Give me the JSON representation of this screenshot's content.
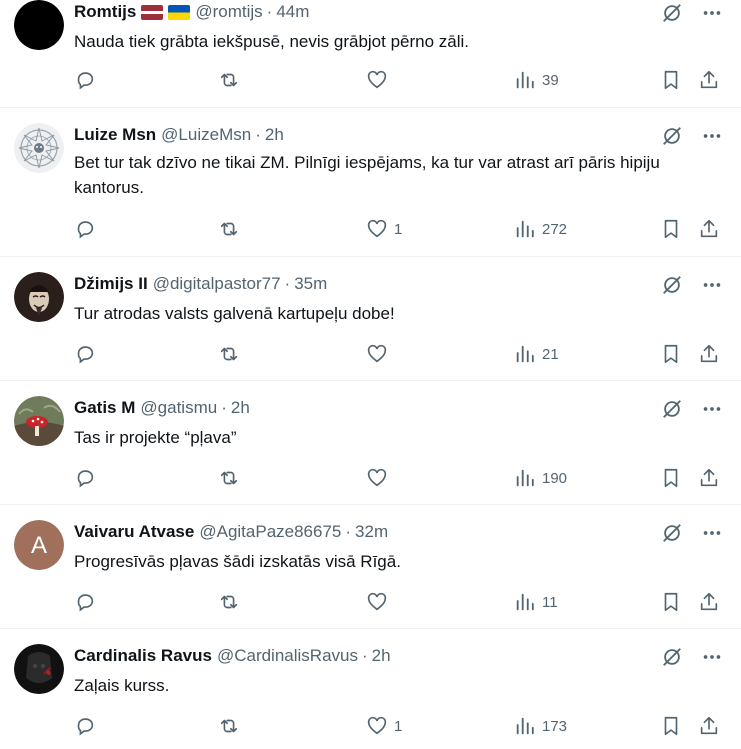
{
  "tweets": [
    {
      "name": "Romtijs",
      "flags": [
        "Latvia flag",
        "Ukraine flag"
      ],
      "handle": "@romtijs",
      "time": "44m",
      "text": "Nauda tiek grābta iekšpusē, nevis grābjot pērno zāli.",
      "replies": "",
      "retweets": "",
      "likes": "",
      "views": "39"
    },
    {
      "name": "Luize Msn",
      "handle": "@LuizeMsn",
      "time": "2h",
      "text": "Bet tur tak dzīvo ne tikai ZM. Pilnīgi iespējams, ka tur var atrast arī pāris hipiju kantorus.",
      "replies": "",
      "retweets": "",
      "likes": "1",
      "views": "272"
    },
    {
      "name": "Džimijs II",
      "handle": "@digitalpastor77",
      "time": "35m",
      "text": "Tur atrodas valsts galvenā kartupeļu dobe!",
      "replies": "",
      "retweets": "",
      "likes": "",
      "views": "21"
    },
    {
      "name": "Gatis M",
      "handle": "@gatismu",
      "time": "2h",
      "text": "Tas ir projekte “pļava”",
      "replies": "",
      "retweets": "",
      "likes": "",
      "views": "190"
    },
    {
      "name": "Vaivaru Atvase",
      "handle": "@AgitaPaze86675",
      "time": "32m",
      "avatar_letter": "A",
      "text": "Progresīvās pļavas šādi izskatās visā Rīgā.",
      "replies": "",
      "retweets": "",
      "likes": "",
      "views": "11"
    },
    {
      "name": "Cardinalis Ravus",
      "handle": "@CardinalisRavus",
      "time": "2h",
      "text": "Zaļais kurss.",
      "replies": "",
      "retweets": "",
      "likes": "1",
      "views": "173"
    }
  ],
  "separator": "·",
  "icons": {
    "grok": "grok-icon",
    "more": "more-icon",
    "reply": "reply-icon",
    "retweet": "retweet-icon",
    "like": "heart-icon",
    "views": "views-icon",
    "bookmark": "bookmark-icon",
    "share": "share-icon"
  },
  "colors": {
    "text": "#0f1419",
    "secondary": "#536471",
    "divider": "#eff3f4",
    "latvia_red": "#9e3039",
    "ukraine_blue": "#0057b7",
    "ukraine_yellow": "#ffd700",
    "letter_avatar": "#a1705c"
  }
}
